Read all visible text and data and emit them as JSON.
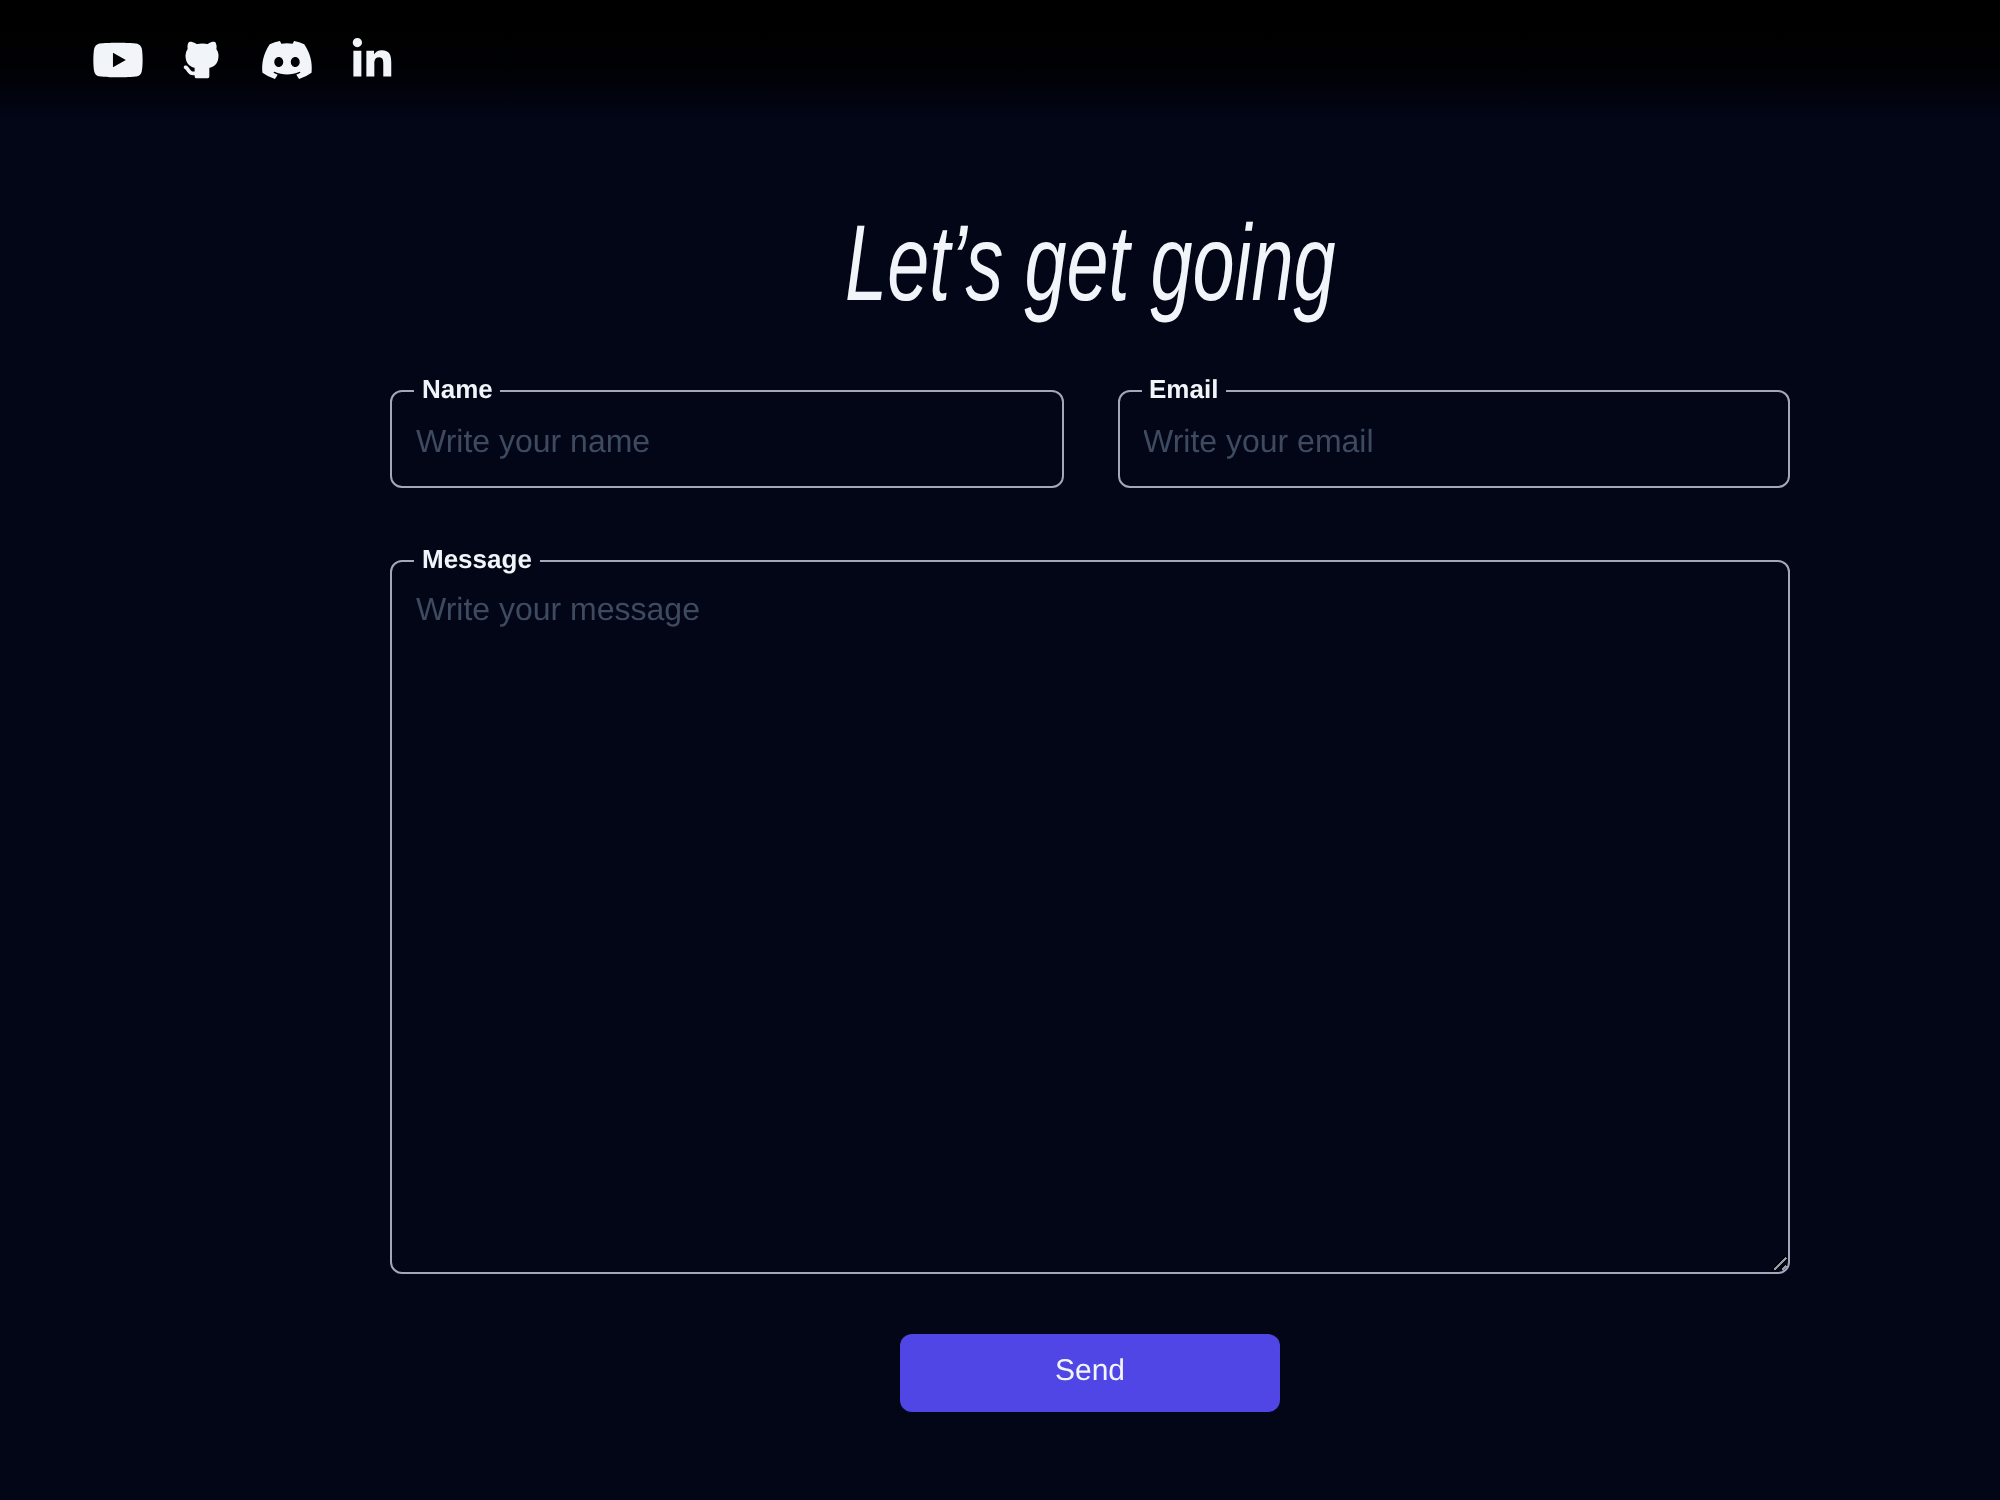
{
  "title": "Let’s get going",
  "form": {
    "fields": [
      {
        "kind": "input",
        "label": "Name",
        "placeholder": "Write your name"
      },
      {
        "kind": "input",
        "label": "Email",
        "placeholder": "Write your email"
      },
      {
        "kind": "textarea",
        "label": "Message",
        "placeholder": "Write your message"
      }
    ],
    "submit": "Send"
  }
}
